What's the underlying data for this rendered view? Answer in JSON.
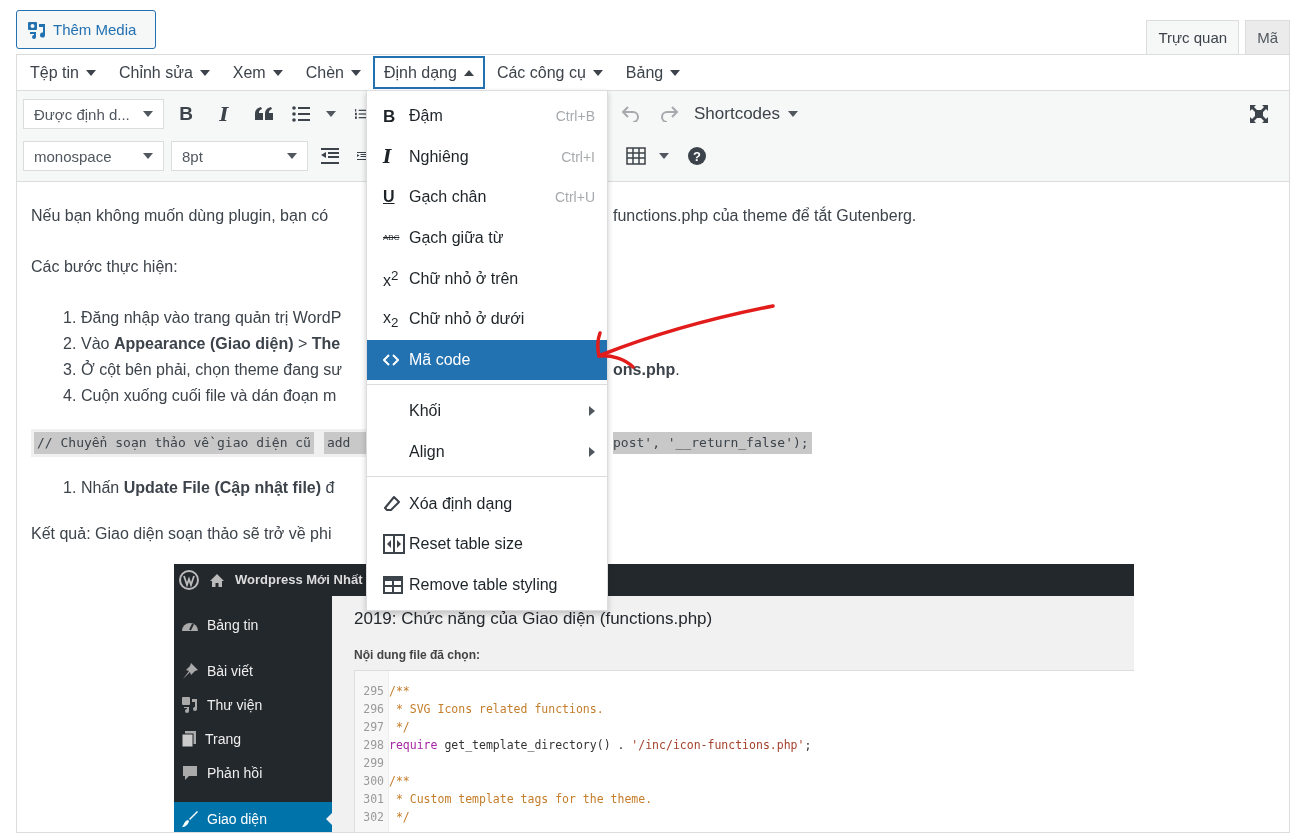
{
  "media_button": {
    "label": "Thêm Media"
  },
  "editor_tabs": [
    {
      "label": "Trực quan",
      "selected": true
    },
    {
      "label": "Mã",
      "selected": false
    }
  ],
  "menubar": [
    {
      "label": "Tệp tin",
      "open": false
    },
    {
      "label": "Chỉnh sửa",
      "open": false
    },
    {
      "label": "Xem",
      "open": false
    },
    {
      "label": "Chèn",
      "open": false
    },
    {
      "label": "Định dạng",
      "open": true
    },
    {
      "label": "Các công cụ",
      "open": false
    },
    {
      "label": "Bảng",
      "open": false
    }
  ],
  "toolbar": {
    "format_select": "Được định d...",
    "bold_glyph": "B",
    "italic_glyph": "I",
    "undo": {
      "disabled": true
    },
    "redo": {
      "disabled": true
    },
    "shortcodes": "Shortcodes",
    "font_select": "monospace",
    "size_select": "8pt",
    "help_glyph": "?"
  },
  "content": [
    {
      "kind": "paragraph",
      "left": "Nếu bạn không muốn dùng plugin, bạn có",
      "right": "functions.php của theme để tắt Gutenberg."
    },
    {
      "kind": "paragraph",
      "left": "Các bước thực hiện:"
    },
    {
      "kind": "list",
      "items": [
        {
          "number": "1.",
          "left": "Đăng nhập vào trang quản trị WordP"
        },
        {
          "number": "2.",
          "left": "Vào **Appearance (Giao diện)** > **The**"
        },
        {
          "number": "3.",
          "left": "Ở cột bên phải, chọn theme đang sư",
          "right": "**ons.php**."
        },
        {
          "number": "4.",
          "left": "Cuộn xuống cuối file và dán đoạn m"
        }
      ]
    },
    {
      "kind": "code",
      "left": [
        "// Chuyển soạn thảo về giao diện cũ",
        "add"
      ],
      "right": "post', '__return_false');"
    },
    {
      "kind": "list",
      "items": [
        {
          "number": "1.",
          "left": "Nhấn **Update File (Cập nhật file)** đ"
        }
      ]
    },
    {
      "kind": "paragraph",
      "left": "Kết quả: Giao diện soạn thảo sẽ trở về phi"
    },
    {
      "kind": "screenshot",
      "site_title": "Wordpress Mới Nhất",
      "sidebar": [
        {
          "label": "Bảng tin",
          "selected": false
        },
        {
          "label": "Bài viết",
          "selected": false
        },
        {
          "label": "Thư viện",
          "selected": false
        },
        {
          "label": "Trang",
          "selected": false
        },
        {
          "label": "Phản hồi",
          "selected": false
        },
        {
          "label": "Giao diện",
          "selected": true
        }
      ],
      "page_title": "2019: Chức năng của Giao diện (functions.php)",
      "file_label": "Nội dung file đã chọn:",
      "code_lines": [
        {
          "number": "295",
          "tokens": [
            {
              "kind": "comment",
              "text": "/**"
            }
          ]
        },
        {
          "number": "296",
          "tokens": [
            {
              "kind": "comment",
              "text": " * SVG Icons related functions."
            }
          ]
        },
        {
          "number": "297",
          "tokens": [
            {
              "kind": "comment",
              "text": " */"
            }
          ]
        },
        {
          "number": "298",
          "tokens": [
            {
              "kind": "keyword",
              "text": "require"
            },
            {
              "kind": "plain",
              "text": " get_template_directory() . "
            },
            {
              "kind": "string",
              "text": "'/inc/icon-functions.php'"
            },
            {
              "kind": "plain",
              "text": ";"
            }
          ]
        },
        {
          "number": "299"
        },
        {
          "number": "300",
          "tokens": [
            {
              "kind": "comment",
              "text": "/**"
            }
          ]
        },
        {
          "number": "301",
          "tokens": [
            {
              "kind": "comment",
              "text": " * Custom template tags for the theme."
            }
          ]
        },
        {
          "number": "302",
          "tokens": [
            {
              "kind": "comment",
              "text": " */"
            }
          ]
        }
      ]
    }
  ],
  "format_menu": {
    "groups": [
      [
        {
          "kind": "action",
          "glyph": "B",
          "label": "Đậm",
          "shortcut": "Ctrl+B",
          "selected": false
        },
        {
          "kind": "action",
          "glyph": "I",
          "label": "Nghiêng",
          "shortcut": "Ctrl+I",
          "selected": false
        },
        {
          "kind": "action",
          "glyph": "U",
          "label": "Gạch chân",
          "shortcut": "Ctrl+U",
          "selected": false
        },
        {
          "kind": "action",
          "glyph": "ABC",
          "label": "Gạch giữa từ",
          "selected": false
        },
        {
          "kind": "action",
          "glyph": "x$^{2}$",
          "label": "Chữ nhỏ ở trên",
          "selected": false
        },
        {
          "kind": "action",
          "glyph": "x$_{2}$",
          "label": "Chữ nhỏ ở dưới",
          "selected": false
        },
        {
          "kind": "action",
          "label": "Mã code",
          "selected": true
        }
      ],
      [
        {
          "kind": "submenu",
          "label": "Khối",
          "selected": false
        },
        {
          "kind": "submenu",
          "label": "Align",
          "selected": false
        }
      ],
      [
        {
          "kind": "action",
          "label": "Xóa định dạng",
          "selected": false
        },
        {
          "kind": "action",
          "label": "Reset table size",
          "selected": false
        },
        {
          "kind": "action",
          "label": "Remove table styling",
          "selected": false
        }
      ]
    ]
  }
}
